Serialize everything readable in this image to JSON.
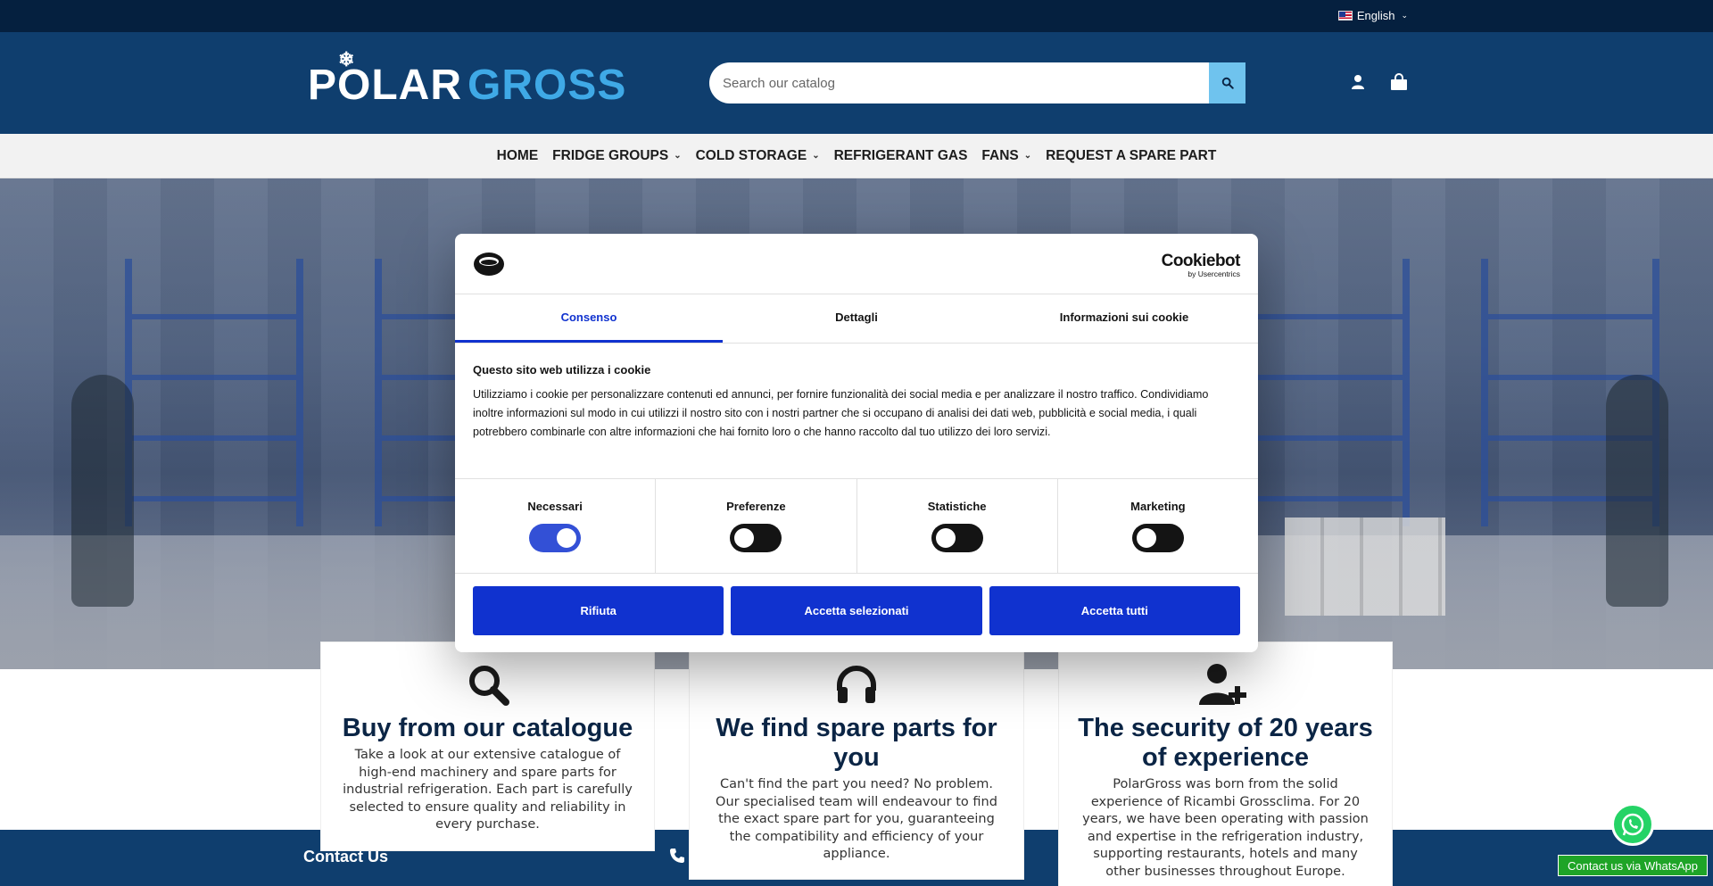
{
  "topbar": {
    "language": "English"
  },
  "header": {
    "logo_part1": "POLAR",
    "logo_part2": "GROSS",
    "search_placeholder": "Search our catalog"
  },
  "nav": {
    "items": [
      {
        "label": "HOME",
        "has_dropdown": false
      },
      {
        "label": "FRIDGE GROUPS",
        "has_dropdown": true
      },
      {
        "label": "COLD STORAGE",
        "has_dropdown": true
      },
      {
        "label": "REFRIGERANT GAS",
        "has_dropdown": false
      },
      {
        "label": "FANS",
        "has_dropdown": true
      },
      {
        "label": "REQUEST A SPARE PART",
        "has_dropdown": false
      }
    ]
  },
  "features": [
    {
      "icon": "search-icon",
      "title": "Buy from our catalogue",
      "text": "Take a look at our extensive catalogue of high-end machinery and spare parts for industrial refrigeration. Each part is carefully selected to ensure quality and reliability in every purchase."
    },
    {
      "icon": "headphones-icon",
      "title": "We find spare parts for you",
      "text": "Can't find the part you need? No problem. Our specialised team will endeavour to find the exact spare part for you, guaranteeing the compatibility and efficiency of your appliance."
    },
    {
      "icon": "user-plus-icon",
      "title": "The security of 20 years of experience",
      "text": "PolarGross was born from the solid experience of Ricambi Grossclima. For 20 years, we have been operating with passion and expertise in the refrigeration industry, supporting restaurants, hotels and many other businesses throughout Europe."
    }
  ],
  "footer": {
    "contact_title": "Contact Us"
  },
  "whatsapp": {
    "label": "Contact us via WhatsApp"
  },
  "cookie": {
    "brand": "Cookiebot",
    "brand_sub": "by Usercentrics",
    "tabs": [
      {
        "label": "Consenso",
        "active": true
      },
      {
        "label": "Dettagli",
        "active": false
      },
      {
        "label": "Informazioni sui cookie",
        "active": false
      }
    ],
    "heading": "Questo sito web utilizza i cookie",
    "body": "Utilizziamo i cookie per personalizzare contenuti ed annunci, per fornire funzionalità dei social media e per analizzare il nostro traffico. Condividiamo inoltre informazioni sul modo in cui utilizzi il nostro sito con i nostri partner che si occupano di analisi dei dati web, pubblicità e social media, i quali potrebbero combinarle con altre informazioni che hai fornito loro o che hanno raccolto dal tuo utilizzo dei loro servizi.",
    "toggles": [
      {
        "label": "Necessari",
        "on": true
      },
      {
        "label": "Preferenze",
        "on": false
      },
      {
        "label": "Statistiche",
        "on": false
      },
      {
        "label": "Marketing",
        "on": false
      }
    ],
    "buttons": {
      "reject": "Rifiuta",
      "accept_selected": "Accetta selezionati",
      "accept_all": "Accetta tutti"
    }
  },
  "colors": {
    "topbar": "#05203f",
    "header": "#0f3e6e",
    "accent_light_blue": "#3fa9e6",
    "cookie_blue": "#1032cf",
    "whatsapp_green": "#25d366"
  }
}
